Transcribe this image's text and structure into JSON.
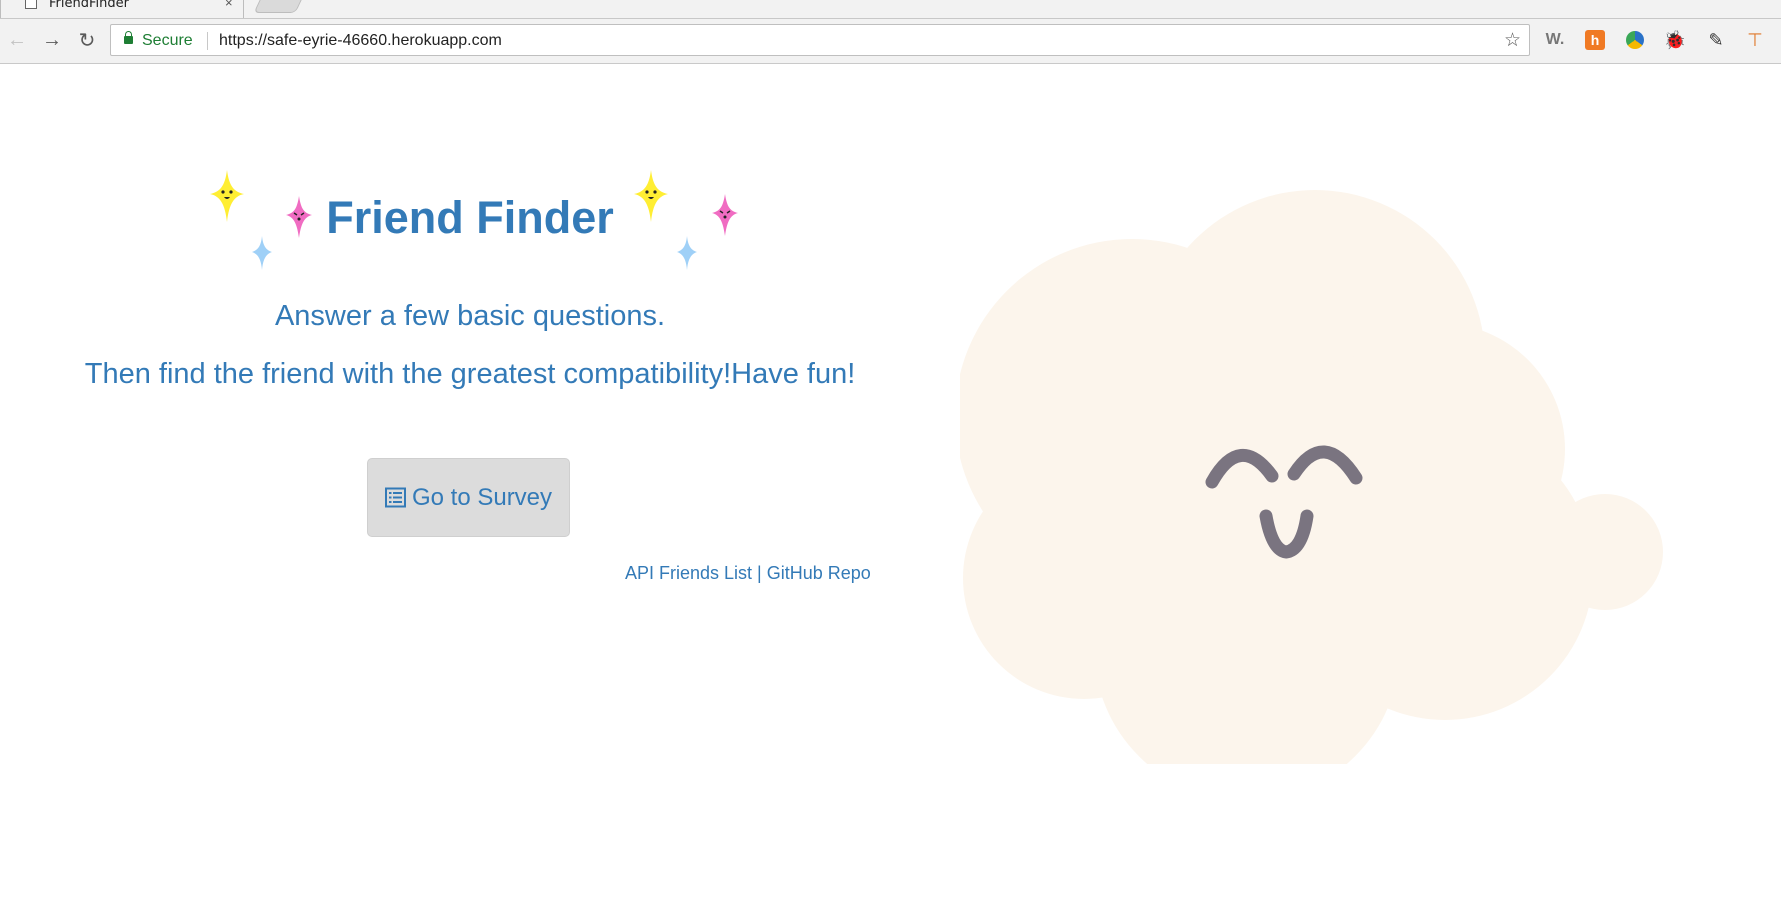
{
  "browser": {
    "tab_title": "FriendFinder",
    "close_glyph": "×",
    "secure_label": "Secure",
    "url": "https://safe-eyrie-46660.herokuapp.com",
    "back_glyph": "←",
    "forward_glyph": "→",
    "reload_glyph": "↻",
    "star_glyph": "☆",
    "extensions": [
      {
        "name": "w-icon",
        "glyph": "W."
      },
      {
        "name": "h-icon",
        "glyph": "h"
      },
      {
        "name": "chart-icon",
        "glyph": ""
      },
      {
        "name": "bug-icon",
        "glyph": "🐞"
      },
      {
        "name": "eyedropper-icon",
        "glyph": "✎"
      },
      {
        "name": "pipe-icon",
        "glyph": "⊤"
      }
    ]
  },
  "main": {
    "title": "Friend Finder",
    "intro_line1": "Answer a few basic questions.",
    "intro_line2": "Then find the friend with the greatest compatibility!Have fun!",
    "survey_button": "Go to Survey",
    "api_link": "API Friends List",
    "separator": " | ",
    "github_link": "GitHub Repo"
  },
  "colors": {
    "link": "#337ab7",
    "cloud": "#fcf5ec",
    "face": "#7a7480",
    "sparkle_yellow": "#ffee33",
    "sparkle_pink": "#f06cc2",
    "sparkle_blue": "#9fd0f7"
  }
}
